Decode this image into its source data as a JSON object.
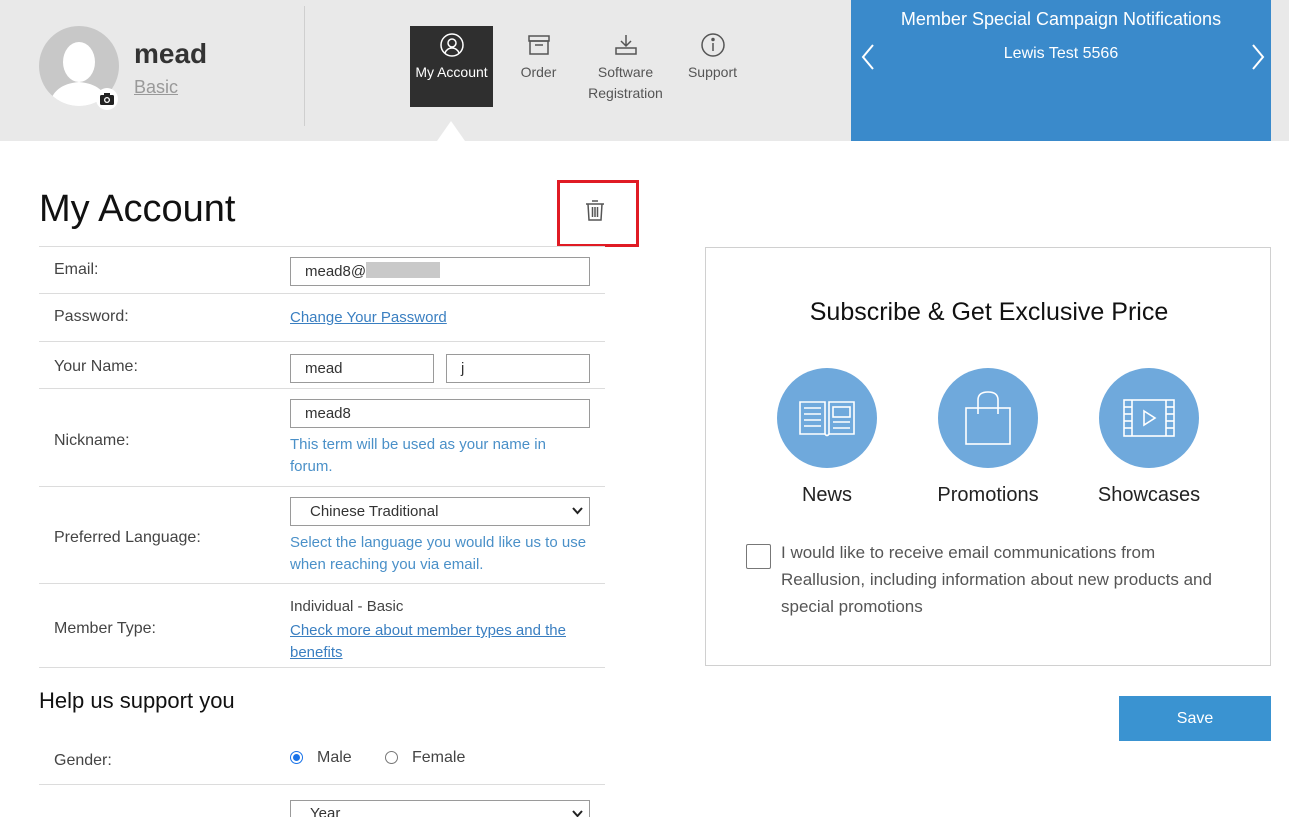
{
  "user": {
    "name": "mead",
    "level": "Basic"
  },
  "nav": {
    "items": [
      {
        "label": "My Account",
        "icon": "user-circle-icon"
      },
      {
        "label": "Order",
        "icon": "order-box-icon"
      },
      {
        "label": "Software Registration",
        "icon": "download-icon"
      },
      {
        "label": "Support",
        "icon": "info-icon"
      }
    ]
  },
  "campaign": {
    "title": "Member Special Campaign Notifications",
    "text": "Lewis Test 5566"
  },
  "page": {
    "title": "My Account"
  },
  "form": {
    "email_label": "Email:",
    "email_value": "mead8@",
    "password_label": "Password:",
    "password_link": "Change Your Password",
    "name_label": "Your Name:",
    "first_name": "mead",
    "last_name": "j",
    "nickname_label": "Nickname:",
    "nickname_value": "mead8",
    "nickname_hint": "This term will be used as your name in forum.",
    "language_label": "Preferred Language:",
    "language_value": "Chinese Traditional",
    "language_hint": "Select the language you would like us to use when reaching you via email.",
    "member_type_label": "Member Type:",
    "member_type_value": "Individual - Basic",
    "member_type_link": "Check more about member types and the benefits"
  },
  "support": {
    "title": "Help us support you",
    "gender_label": "Gender:",
    "gender_options": [
      "Male",
      "Female"
    ],
    "gender_selected": "Male",
    "year_placeholder": "Year"
  },
  "subscribe": {
    "title": "Subscribe & Get Exclusive Price",
    "categories": [
      {
        "label": "News",
        "icon": "news-icon"
      },
      {
        "label": "Promotions",
        "icon": "shopping-bag-icon"
      },
      {
        "label": "Showcases",
        "icon": "video-icon"
      }
    ],
    "consent_text": "I would like to receive email communications from Reallusion, including information about new products and special promotions",
    "consent_checked": false
  },
  "actions": {
    "save_label": "Save"
  },
  "colors": {
    "accent": "#3a8acb",
    "highlight": "#e01b24",
    "hint": "#4a90c8"
  }
}
